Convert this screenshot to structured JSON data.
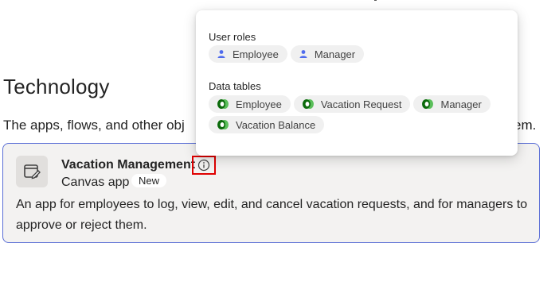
{
  "section": {
    "title": "Technology",
    "description_start": "The apps, flows, and other obj",
    "description_end": "em."
  },
  "card": {
    "app_name": "Vacation Management",
    "app_type": "Canvas app",
    "badge": "New",
    "description": "An app for employees to log, view, edit, and cancel vacation requests, and for managers to approve or reject them.",
    "icon": "canvas-app-icon",
    "border_color": "#5b6fd6"
  },
  "popover": {
    "user_roles_heading": "User roles",
    "user_roles": [
      {
        "label": "Employee",
        "icon": "person-icon"
      },
      {
        "label": "Manager",
        "icon": "person-icon"
      }
    ],
    "data_tables_heading": "Data tables",
    "data_tables": [
      {
        "label": "Employee",
        "icon": "dataverse-icon"
      },
      {
        "label": "Vacation Request",
        "icon": "dataverse-icon"
      },
      {
        "label": "Manager",
        "icon": "dataverse-icon"
      },
      {
        "label": "Vacation Balance",
        "icon": "dataverse-icon"
      }
    ]
  },
  "colors": {
    "person_icon": "#4f6bed",
    "dataverse_dark": "#0b6a0b",
    "dataverse_light": "#5bbf5b",
    "highlight": "#e00000"
  }
}
